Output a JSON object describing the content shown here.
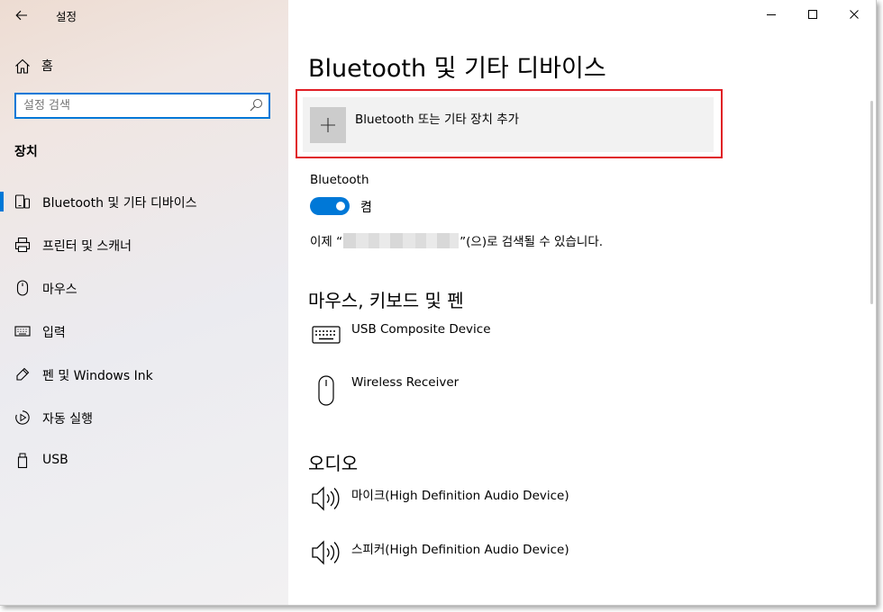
{
  "window": {
    "app_title": "설정",
    "controls": {
      "minimize": "minimize-icon",
      "maximize": "maximize-icon",
      "close": "close-icon"
    }
  },
  "sidebar": {
    "home_label": "홈",
    "search": {
      "placeholder": "설정 검색",
      "value": ""
    },
    "section_title": "장치",
    "items": [
      {
        "label": "Bluetooth 및 기타 디바이스",
        "icon": "bluetooth-devices-icon",
        "active": true
      },
      {
        "label": "프린터 및 스캐너",
        "icon": "printer-icon",
        "active": false
      },
      {
        "label": "마우스",
        "icon": "mouse-icon",
        "active": false
      },
      {
        "label": "입력",
        "icon": "keyboard-icon",
        "active": false
      },
      {
        "label": "펜 및 Windows Ink",
        "icon": "pen-icon",
        "active": false
      },
      {
        "label": "자동 실행",
        "icon": "autoplay-icon",
        "active": false
      },
      {
        "label": "USB",
        "icon": "usb-icon",
        "active": false
      }
    ]
  },
  "main": {
    "title": "Bluetooth 및 기타 디바이스",
    "add_device_label": "Bluetooth 또는 기타 장치 추가",
    "bluetooth": {
      "label": "Bluetooth",
      "toggle_state": "켬",
      "on": true,
      "discover_prefix": "이제 “",
      "discover_suffix": "”(으)로 검색될 수 있습니다."
    },
    "groups": [
      {
        "title": "마우스, 키보드 및 펜",
        "devices": [
          {
            "name": "USB Composite Device",
            "icon": "keyboard-icon"
          },
          {
            "name": "Wireless Receiver",
            "icon": "mouse-icon"
          }
        ]
      },
      {
        "title": "오디오",
        "devices": [
          {
            "name": "마이크(High Definition Audio Device)",
            "icon": "speaker-icon"
          },
          {
            "name": "스피커(High Definition Audio Device)",
            "icon": "speaker-icon"
          }
        ]
      }
    ]
  },
  "colors": {
    "accent": "#0078d7",
    "highlight_border": "#e01e25",
    "tile_bg": "#f2f2f2"
  }
}
